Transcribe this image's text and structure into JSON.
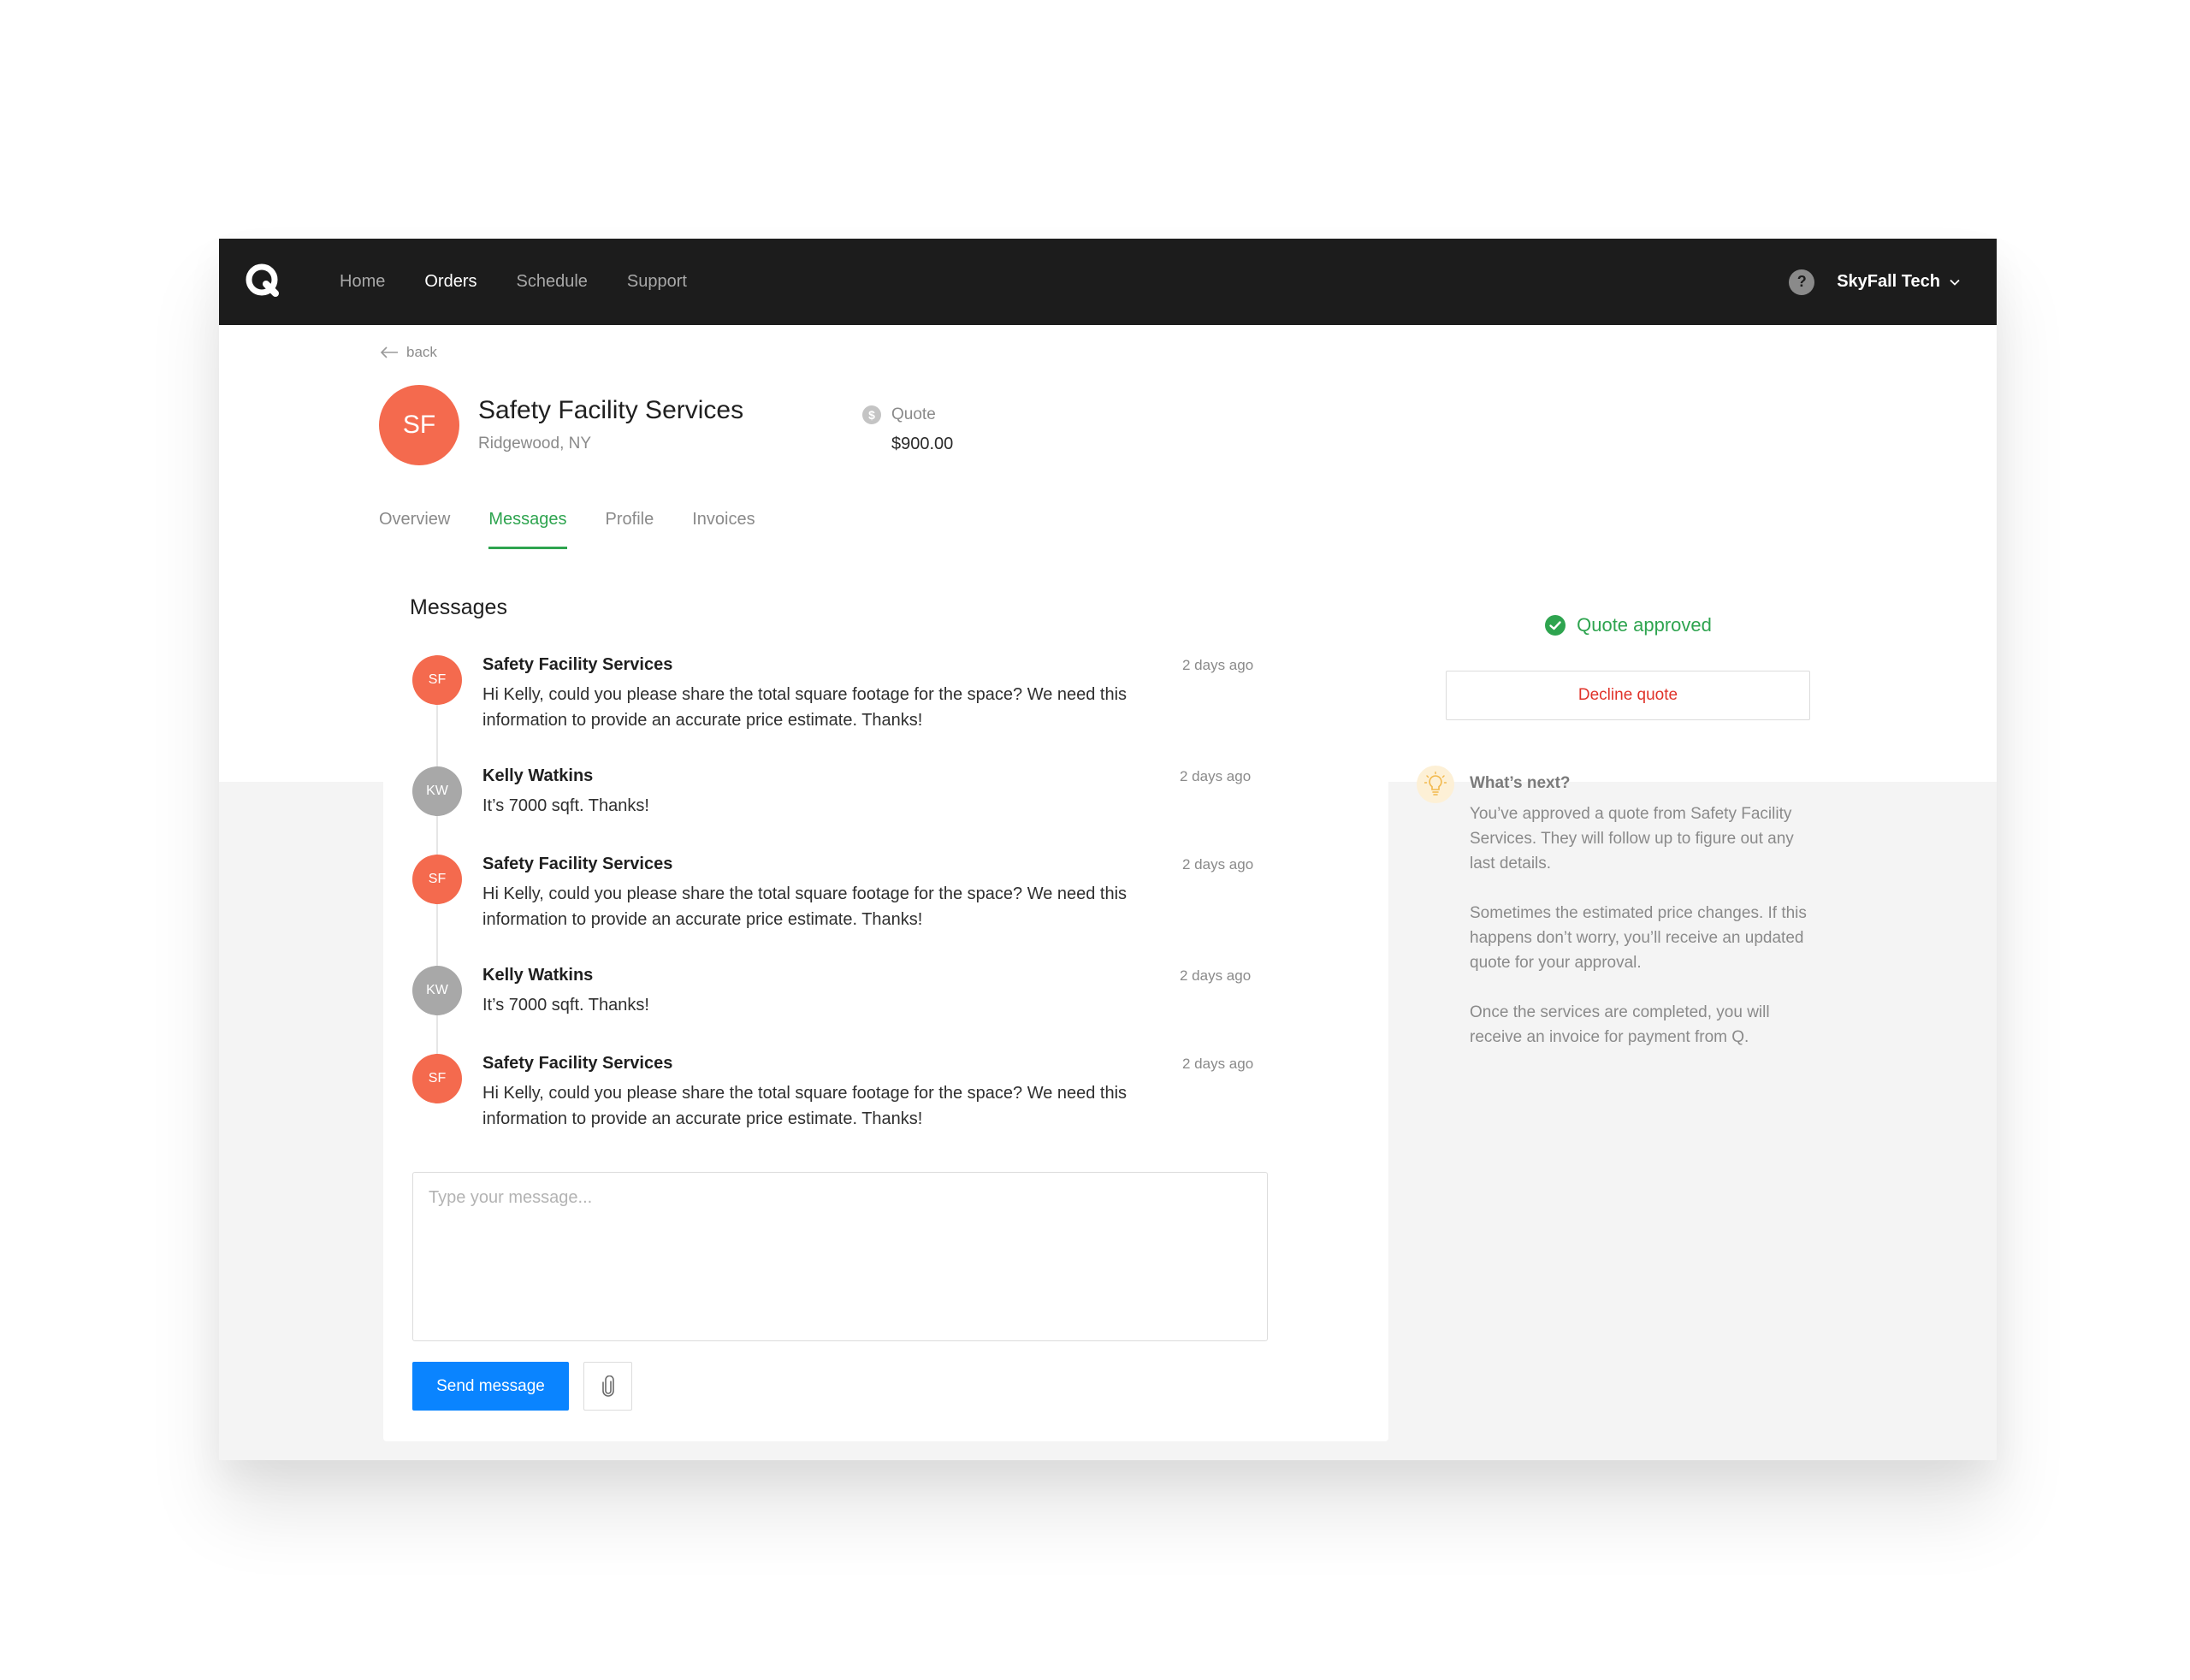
{
  "nav": {
    "links": [
      "Home",
      "Orders",
      "Schedule",
      "Support"
    ],
    "active": "Orders",
    "account_name": "SkyFall Tech",
    "help_label": "?"
  },
  "header": {
    "back_label": "back",
    "avatar_initials": "SF",
    "company_name": "Safety Facility Services",
    "location": "Ridgewood, NY",
    "quote_label": "Quote",
    "quote_amount": "$900.00"
  },
  "tabs": [
    "Overview",
    "Messages",
    "Profile",
    "Invoices"
  ],
  "active_tab": "Messages",
  "messages": {
    "title": "Messages",
    "items": [
      {
        "initials": "SF",
        "sender": "Safety Facility Services",
        "time": "2 days ago",
        "body": "Hi Kelly, could you please share the total square footage for the space? We need this information to provide an accurate price estimate. Thanks!"
      },
      {
        "initials": "KW",
        "sender": "Kelly Watkins",
        "time": "2 days ago",
        "body": "It’s 7000 sqft. Thanks!"
      },
      {
        "initials": "SF",
        "sender": "Safety Facility Services",
        "time": "2 days ago",
        "body": "Hi Kelly, could you please share the total square footage for the space? We need this information to provide an accurate price estimate. Thanks!"
      },
      {
        "initials": "KW",
        "sender": "Kelly Watkins",
        "time": "2 days ago",
        "body": "It’s 7000 sqft. Thanks!"
      },
      {
        "initials": "SF",
        "sender": "Safety Facility Services",
        "time": "2 days ago",
        "body": "Hi Kelly, could you please share the total square footage for the space? We need this information to provide an accurate price estimate. Thanks!"
      }
    ],
    "compose_placeholder": "Type your message...",
    "send_label": "Send message"
  },
  "status": {
    "approved_label": "Quote approved",
    "decline_label": "Decline quote"
  },
  "next_steps": {
    "title": "What’s next?",
    "paragraphs": [
      "You’ve approved a quote from Safety Facility Services. They will follow up to figure out any last details.",
      "Sometimes the estimated price changes. If this happens don’t worry, you’ll receive an updated quote for your approval.",
      "Once the services are completed, you will receive an invoice for payment from Q."
    ]
  },
  "colors": {
    "nav_bg": "#1c1c1c",
    "accent_green": "#2ea44f",
    "primary_blue": "#0a84ff",
    "avatar_orange": "#f46a4e",
    "danger_red": "#e0332a"
  }
}
